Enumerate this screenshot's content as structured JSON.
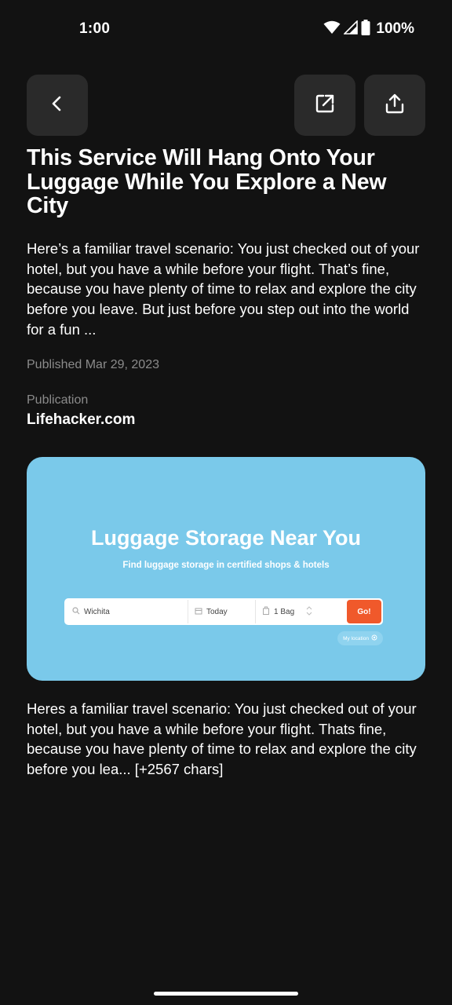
{
  "status": {
    "time": "1:00",
    "battery": "100%"
  },
  "toolbar": {
    "back_icon": "chevron-left-icon",
    "open_external_icon": "open-external-icon",
    "share_icon": "share-icon"
  },
  "article": {
    "title": "This Service Will Hang Onto Your Luggage While You Explore a New City",
    "summary": "Here’s a familiar travel scenario: You just checked out of your hotel, but you have a while before your flight. That’s fine, because you have plenty of time to relax and explore the city before you leave. But just before you step out into the world for a fun ...",
    "published": "Published Mar 29, 2023",
    "publication_label": "Publication",
    "publication_name": "Lifehacker.com",
    "body": "Heres a familiar travel scenario: You just checked out of your hotel, but you have a while before your flight. Thats fine, because you have plenty of time to relax and explore the city before you lea... [+2567 chars]"
  },
  "hero_image": {
    "heading": "Luggage Storage Near You",
    "subheading": "Find luggage storage in certified shops & hotels",
    "location": "Wichita",
    "date": "Today",
    "bags": "1 Bag",
    "go": "Go!",
    "my_location": "My location",
    "colors": {
      "background": "#7ac9ea",
      "button": "#f0592b"
    }
  },
  "colors": {
    "background": "#121212",
    "button_bg": "#2a2a2a",
    "muted_text": "#8b8b8b"
  }
}
